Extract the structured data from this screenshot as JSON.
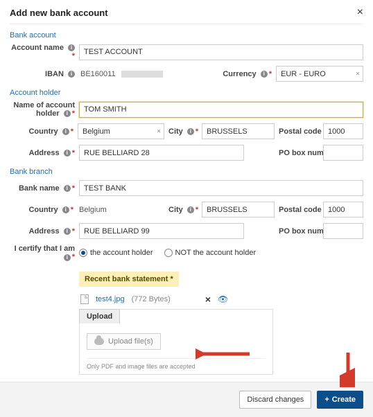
{
  "header": {
    "title": "Add new bank account",
    "close_label": "×"
  },
  "sections": {
    "bank_account": {
      "title": "Bank account",
      "account_name_label": "Account name",
      "account_name_value": "TEST ACCOUNT",
      "iban_label": "IBAN",
      "iban_prefix": "BE160011",
      "currency_label": "Currency",
      "currency_value": "EUR - EURO"
    },
    "account_holder": {
      "title": "Account holder",
      "name_label": "Name of account holder",
      "name_value": "TOM SMITH",
      "country_label": "Country",
      "country_value": "Belgium",
      "city_label": "City",
      "city_value": "BRUSSELS",
      "postal_label": "Postal code",
      "postal_value": "1000",
      "address_label": "Address",
      "address_value": "RUE BELLIARD 28",
      "pobox_label": "PO box number",
      "pobox_value": ""
    },
    "bank_branch": {
      "title": "Bank branch",
      "bank_name_label": "Bank name",
      "bank_name_value": "TEST BANK",
      "country_label": "Country",
      "country_value": "Belgium",
      "city_label": "City",
      "city_value": "BRUSSELS",
      "postal_label": "Postal code",
      "postal_value": "1000",
      "address_label": "Address",
      "address_value": "RUE BELLIARD 99",
      "pobox_label": "PO box number",
      "pobox_value": ""
    },
    "certify": {
      "label": "I certify that I am",
      "opt_holder": "the account holder",
      "opt_not_holder": "NOT the account holder",
      "selected": "holder"
    },
    "statement": {
      "heading": "Recent bank statement *",
      "file_name": "test4.jpg",
      "file_size": "(772 Bytes)",
      "upload_tab": "Upload",
      "upload_button": "Upload file(s)",
      "note": "Only PDF and image files are accepted"
    }
  },
  "footer": {
    "discard": "Discard changes",
    "create": "Create"
  }
}
